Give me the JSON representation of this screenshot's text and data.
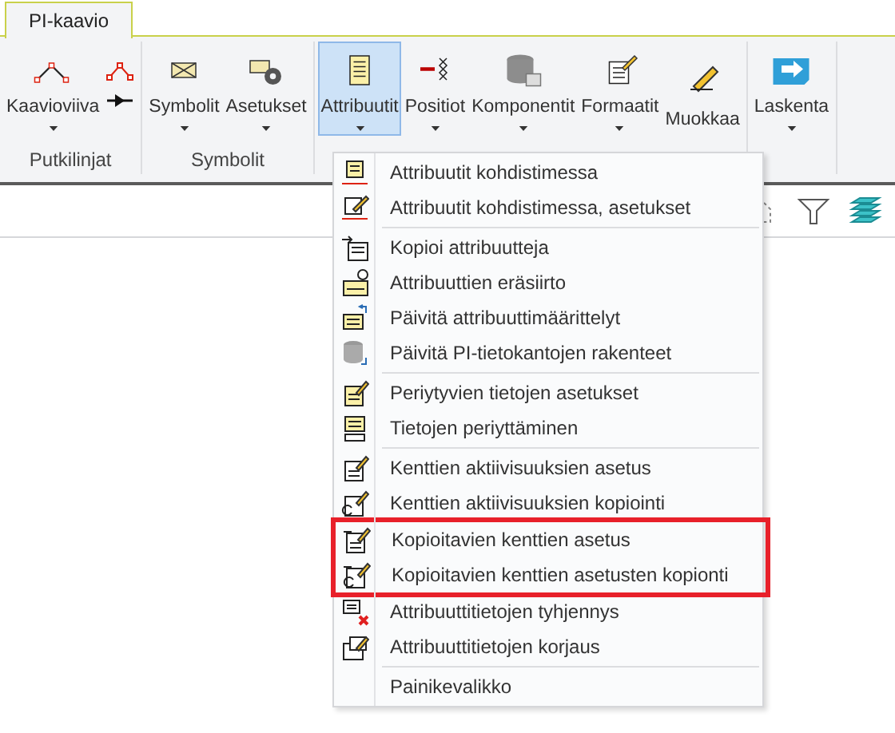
{
  "tabs": [
    {
      "label": "PI-kaavio",
      "selected": true
    }
  ],
  "ribbon_groups": [
    {
      "label": "Putkilinjat",
      "buttons": [
        {
          "kind": "large",
          "label": "Kaavioviiva",
          "dropdown": true,
          "selected": false
        },
        {
          "kind": "small-stack"
        }
      ]
    },
    {
      "label": "Symbolit",
      "buttons": [
        {
          "kind": "large",
          "label": "Symbolit",
          "dropdown": true,
          "selected": false
        },
        {
          "kind": "large",
          "label": "Asetukset",
          "dropdown": true,
          "selected": false
        }
      ]
    },
    {
      "buttons": [
        {
          "kind": "large",
          "label": "Attribuutit",
          "dropdown": true,
          "selected": true
        },
        {
          "kind": "large",
          "label": "Positiot",
          "dropdown": true,
          "selected": false
        },
        {
          "kind": "large",
          "label": "Komponentit",
          "dropdown": true,
          "selected": false
        },
        {
          "kind": "large",
          "label": "Formaatit",
          "dropdown": true,
          "selected": false
        },
        {
          "kind": "large",
          "label": "Muokkaa",
          "dropdown": false,
          "selected": false
        }
      ]
    },
    {
      "buttons": [
        {
          "kind": "large",
          "label": "Laskenta",
          "dropdown": true,
          "selected": false
        }
      ]
    }
  ],
  "dropdown_menu": {
    "sections": [
      [
        {
          "label": "Attribuutit kohdistimessa",
          "highlighted": false
        },
        {
          "label": "Attribuutit kohdistimessa, asetukset",
          "highlighted": false
        }
      ],
      [
        {
          "label": "Kopioi attribuutteja",
          "highlighted": false
        },
        {
          "label": "Attribuuttien eräsiirto",
          "highlighted": false
        },
        {
          "label": "Päivitä attribuuttimäärittelyt",
          "highlighted": false
        },
        {
          "label": "Päivitä PI-tietokantojen rakenteet",
          "highlighted": false
        }
      ],
      [
        {
          "label": "Periytyvien tietojen asetukset",
          "highlighted": false
        },
        {
          "label": "Tietojen periyttäminen",
          "highlighted": false
        }
      ],
      [
        {
          "label": "Kenttien aktiivisuuksien asetus",
          "highlighted": false
        },
        {
          "label": "Kenttien aktiivisuuksien kopiointi",
          "highlighted": false
        },
        {
          "label": "Kopioitavien kenttien asetus",
          "highlighted": true
        },
        {
          "label": "Kopioitavien kenttien asetusten kopionti",
          "highlighted": true
        },
        {
          "label": "Attribuuttitietojen tyhjennys",
          "highlighted": false
        },
        {
          "label": "Attribuuttitietojen korjaus",
          "highlighted": false
        }
      ],
      [
        {
          "label": "Painikevalikko",
          "highlighted": false
        }
      ]
    ]
  }
}
